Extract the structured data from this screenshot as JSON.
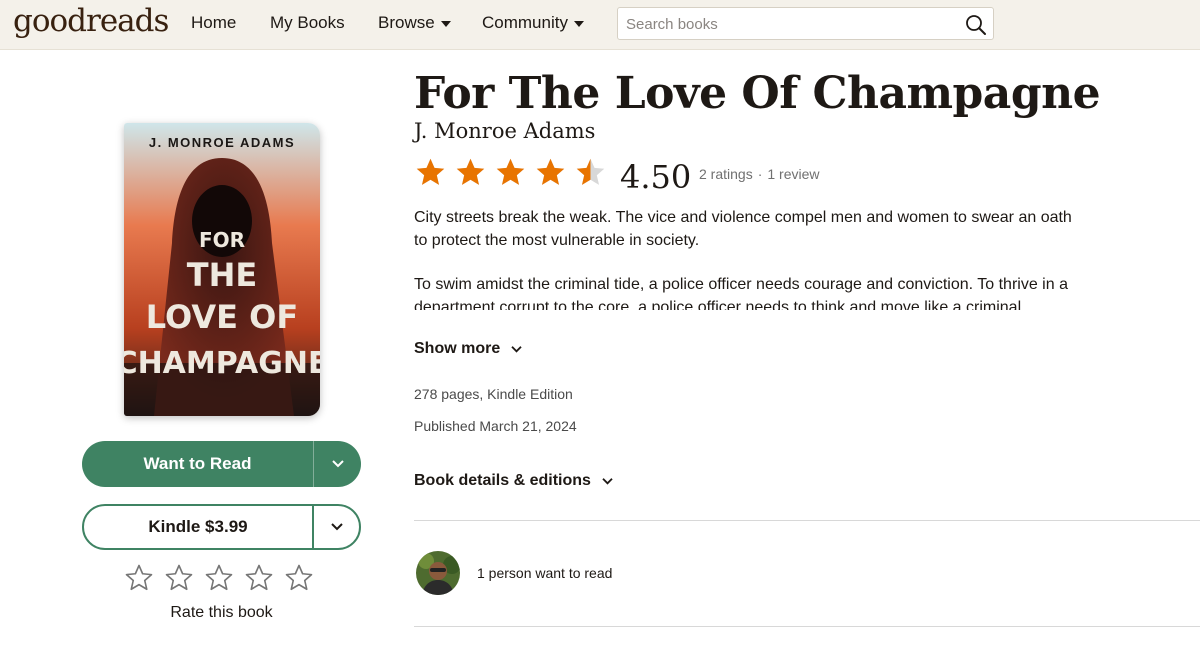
{
  "header": {
    "logo": "goodreads",
    "nav": [
      {
        "label": "Home",
        "dropdown": false
      },
      {
        "label": "My Books",
        "dropdown": false
      },
      {
        "label": "Browse",
        "dropdown": true
      },
      {
        "label": "Community",
        "dropdown": true
      }
    ],
    "search": {
      "placeholder": "Search books",
      "value": ""
    }
  },
  "cover": {
    "author_text": "J. MONROE ADAMS",
    "line1": "FOR",
    "line2": "THE",
    "line3": "LOVE OF",
    "line4": "CHAMPAGNE"
  },
  "actions": {
    "primary_label": "Want to Read",
    "secondary_label": "Kindle $3.99",
    "rate_label": "Rate this book"
  },
  "book": {
    "title": "For The Love Of Champagne",
    "author": "J. Monroe Adams",
    "rating": 4.5,
    "rating_text": "4.50",
    "ratings_count": "2 ratings",
    "separator": "·",
    "reviews_count": "1 review",
    "description_p1": "City streets break the weak. The vice and violence compel men and women to swear an oath to protect the most vulnerable in society.",
    "description_p2": "To swim amidst the criminal tide, a police officer needs courage and conviction. To thrive in a department corrupt to the core, a police officer needs to think and move like a criminal.",
    "show_more": "Show more",
    "pages_format": "278 pages, Kindle Edition",
    "published": "Published March 21, 2024",
    "details_label": "Book details & editions",
    "want_to_read_text": "1 person want to read"
  },
  "colors": {
    "accent_green": "#3f8363",
    "star_orange": "#e87400",
    "header_bg": "#f4f1ea"
  }
}
